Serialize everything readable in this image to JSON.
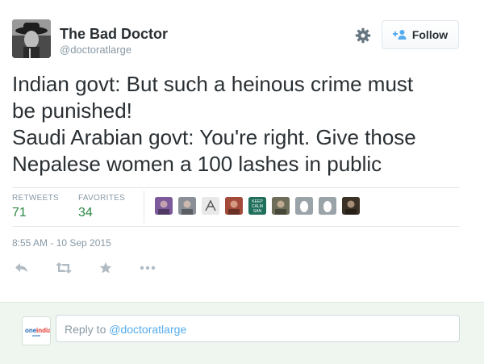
{
  "author": {
    "name": "The Bad Doctor",
    "handle": "@doctoratlarge"
  },
  "header": {
    "follow_label": "Follow",
    "settings_icon": "gear-icon",
    "follow_icon": "add-user-icon"
  },
  "tweet": {
    "lines": [
      "Indian govt: But such a heinous crime must",
      "be punished!",
      "Saudi Arabian govt: You're right. Give those",
      "Nepalese women a 100 lashes in public"
    ]
  },
  "stats": {
    "retweets_label": "RETWEETS",
    "retweets_count": "71",
    "favorites_label": "FAVORITES",
    "favorites_count": "34"
  },
  "favoriters": [
    {
      "kind": "photo",
      "color": "#7c5a9c"
    },
    {
      "kind": "photo",
      "color": "#8a8f98"
    },
    {
      "kind": "sketch",
      "color": "#e9e9e9"
    },
    {
      "kind": "photo",
      "color": "#a34a3a"
    },
    {
      "kind": "keep-calm",
      "color": "#1f6f5c"
    },
    {
      "kind": "photo",
      "color": "#6d6d5a"
    },
    {
      "kind": "egg",
      "color": "#9aa3a8"
    },
    {
      "kind": "egg",
      "color": "#9aa3a8"
    },
    {
      "kind": "photo",
      "color": "#3b3226"
    }
  ],
  "keep_calm_text": [
    "KEEP",
    "CALM",
    "SAN"
  ],
  "timestamp": "8:55 AM - 10 Sep 2015",
  "actions": [
    "reply-icon",
    "retweet-icon",
    "favorite-icon",
    "more-icon"
  ],
  "reply": {
    "prefix": "Reply to ",
    "mention": "@doctoratlarge",
    "logo_text": "oneindia"
  },
  "colors": {
    "stat_value": "#2d8a43",
    "link": "#55acee",
    "muted": "#8899a6",
    "reply_bg": "#eef6ef"
  }
}
